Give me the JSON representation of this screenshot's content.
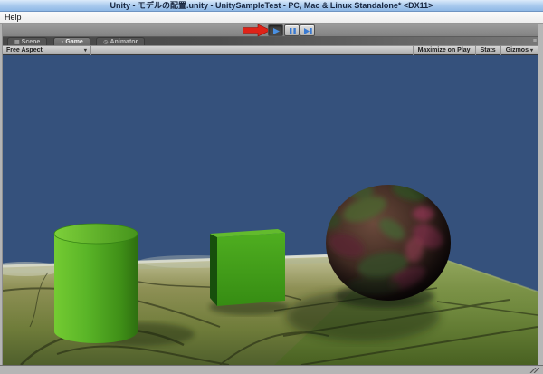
{
  "window": {
    "title": "Unity - モデルの配置.unity - UnitySampleTest - PC, Mac & Linux Standalone* <DX11>",
    "menu_items": [
      {
        "label": "Help"
      }
    ]
  },
  "playbar": {
    "buttons": [
      {
        "id": "play",
        "icon": "play-icon",
        "state": "active"
      },
      {
        "id": "pause",
        "icon": "pause-icon",
        "state": "normal"
      },
      {
        "id": "step",
        "icon": "step-icon",
        "state": "normal"
      }
    ],
    "icon_color": "#4a90e2",
    "annotation": {
      "type": "red-arrow",
      "points_at": "play-button",
      "color": "#df2318"
    }
  },
  "tabs": {
    "active": "Game",
    "items": [
      {
        "label": "Scene",
        "icon": "scene-icon"
      },
      {
        "label": "Game",
        "icon": "game-icon"
      },
      {
        "label": "Animator",
        "icon": "animator-icon"
      }
    ]
  },
  "game_toolbar": {
    "aspect_dropdown": {
      "value": "Free Aspect"
    },
    "buttons": [
      {
        "label": "Maximize on Play"
      },
      {
        "label": "Stats"
      },
      {
        "label": "Gizmos",
        "has_dropdown": true
      }
    ]
  },
  "viewport": {
    "sky_color": "#35517c",
    "ground": {
      "far_color": "#c9c8a0",
      "mid_color": "#8e9055",
      "near_color": "#4f5f2c",
      "edge_highlight_color": "#dfe3da",
      "shadow_color": "#16200a"
    },
    "objects": [
      {
        "name": "cylinder",
        "color": "#4ea31f"
      },
      {
        "name": "cube",
        "color": "#3f9a1a"
      },
      {
        "name": "sphere",
        "color": "#3c2820",
        "texture": "mottled dark red-green"
      }
    ]
  }
}
